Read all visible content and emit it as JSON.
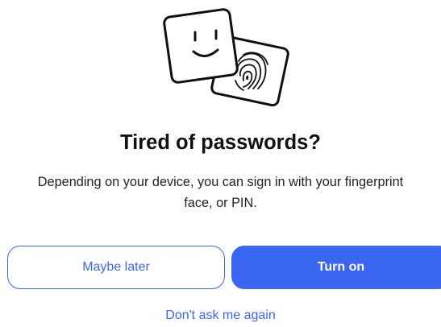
{
  "prompt": {
    "title": "Tired of passwords?",
    "description_lines": [
      "Depending on your device, you can sign in with your fingerprint",
      "face, or PIN."
    ],
    "secondary_button": "Maybe later",
    "primary_button": "Turn on",
    "dismiss_link": "Don't ask me again"
  },
  "illustration": {
    "icons": [
      "smiley-face-card-icon",
      "fingerprint-card-icon"
    ]
  },
  "colors": {
    "accent": "#3a66f2",
    "title": "#111111",
    "body_text": "#222222",
    "background": "#ffffff"
  }
}
